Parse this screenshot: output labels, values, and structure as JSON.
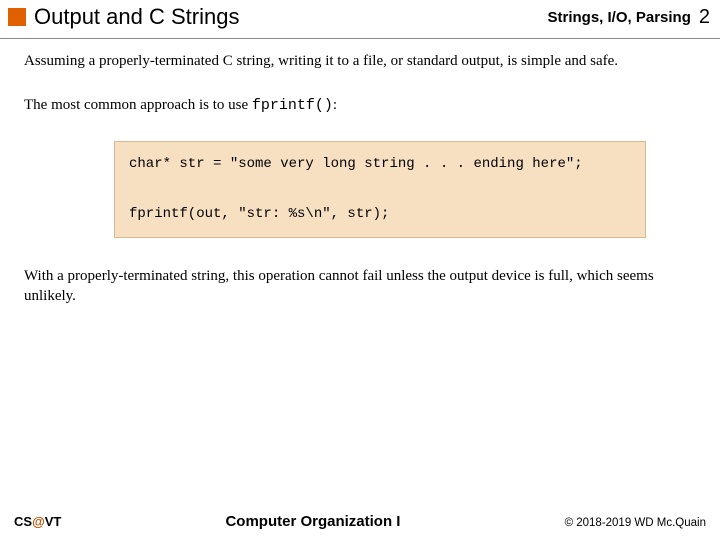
{
  "header": {
    "title": "Output and C Strings",
    "topic": "Strings, I/O, Parsing",
    "page_number": "2"
  },
  "body": {
    "para1": "Assuming a properly-terminated C string, writing it to a file, or standard output, is simple and safe.",
    "para2_prefix": "The most common approach is to use ",
    "para2_code": "fprintf()",
    "para2_suffix": ":",
    "code": "char* str = \"some very long string . . . ending here\";\n\nfprintf(out, \"str: %s\\n\", str);",
    "para3": "With a properly-terminated string, this operation cannot fail unless the output device is full, which seems unlikely."
  },
  "footer": {
    "left_cs": "CS",
    "left_at": "@",
    "left_vt": "VT",
    "center": "Computer Organization I",
    "right": "© 2018-2019 WD Mc.Quain"
  }
}
